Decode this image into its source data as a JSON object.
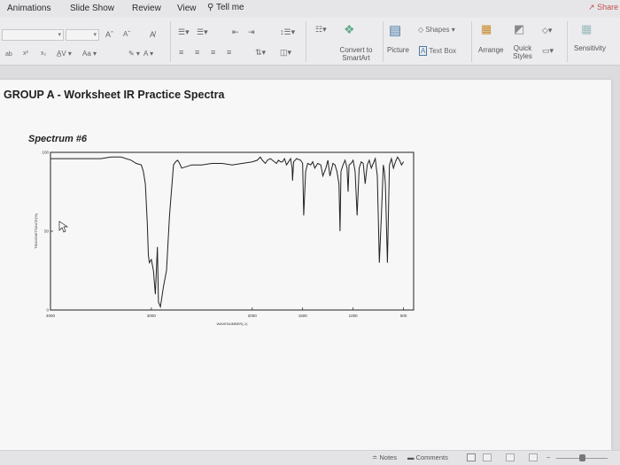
{
  "app": {
    "tabs": [
      "Animations",
      "Slide Show",
      "Review",
      "View"
    ],
    "tell_me": "Tell me",
    "share": "Share"
  },
  "ribbon": {
    "font_size_up": "Aˆ",
    "font_size_down": "Aˇ",
    "change_case": "Aa",
    "convert_smartart_line1": "Convert to",
    "convert_smartart_line2": "SmartArt",
    "picture": "Picture",
    "shapes": "Shapes",
    "text_box": "Text Box",
    "arrange": "Arrange",
    "quick_styles_line1": "Quick",
    "quick_styles_line2": "Styles",
    "sensitivity": "Sensitivity"
  },
  "slide": {
    "title": "GROUP A  -  Worksheet IR Practice Spectra"
  },
  "chart_data": {
    "type": "line",
    "title": "Spectrum #6",
    "xlabel": "WAVENUMBER(-1)",
    "ylabel": "TRANSMITTANCE(%)",
    "x_reversed": true,
    "xlim": [
      4000,
      400
    ],
    "ylim": [
      0,
      100
    ],
    "x_ticks": [
      4000,
      3000,
      2000,
      1500,
      1000,
      500
    ],
    "x_tick_labels": [
      "4000",
      "3000",
      "2000",
      "1500",
      "1000",
      "500"
    ],
    "y_ticks": [
      0,
      50,
      100
    ],
    "y_tick_labels": [
      "0",
      "50",
      "100"
    ],
    "grid": false,
    "series": [
      {
        "x": [
          4000,
          3900,
          3700,
          3500,
          3400,
          3300,
          3200,
          3150,
          3100,
          3080,
          3060,
          3040,
          3030,
          3020,
          3000,
          2980,
          2960,
          2940,
          2930,
          2910,
          2880,
          2850,
          2820,
          2780,
          2760,
          2740,
          2720,
          2700,
          2600,
          2500,
          2400,
          2300,
          2200,
          2100,
          2000,
          1950,
          1920,
          1900,
          1870,
          1850,
          1820,
          1800,
          1760,
          1740,
          1720,
          1700,
          1680,
          1660,
          1640,
          1620,
          1605,
          1600,
          1590,
          1560,
          1520,
          1500,
          1490,
          1470,
          1450,
          1420,
          1400,
          1380,
          1350,
          1320,
          1300,
          1270,
          1250,
          1230,
          1200,
          1180,
          1160,
          1140,
          1130,
          1120,
          1100,
          1080,
          1060,
          1050,
          1040,
          1020,
          1000,
          980,
          960,
          940,
          920,
          900,
          880,
          860,
          840,
          820,
          800,
          780,
          760,
          740,
          720,
          700,
          690,
          680,
          660,
          640,
          620,
          600,
          580,
          560,
          540,
          520,
          500
        ],
        "y": [
          96,
          96,
          96,
          96,
          97,
          97,
          95,
          93,
          92,
          88,
          80,
          55,
          35,
          30,
          32,
          25,
          10,
          40,
          5,
          2,
          15,
          25,
          60,
          92,
          94,
          95,
          93,
          90,
          92,
          92,
          93,
          93,
          92,
          93,
          94,
          95,
          97,
          95,
          93,
          95,
          96,
          95,
          93,
          95,
          94,
          94,
          96,
          92,
          94,
          96,
          90,
          82,
          94,
          96,
          95,
          93,
          60,
          88,
          93,
          92,
          94,
          90,
          93,
          92,
          85,
          90,
          95,
          85,
          93,
          92,
          88,
          80,
          50,
          88,
          92,
          95,
          90,
          75,
          92,
          93,
          95,
          88,
          60,
          90,
          94,
          93,
          80,
          92,
          95,
          90,
          93,
          96,
          85,
          30,
          60,
          92,
          88,
          80,
          30,
          92,
          96,
          90,
          94,
          97,
          95,
          92,
          94
        ]
      }
    ]
  }
}
